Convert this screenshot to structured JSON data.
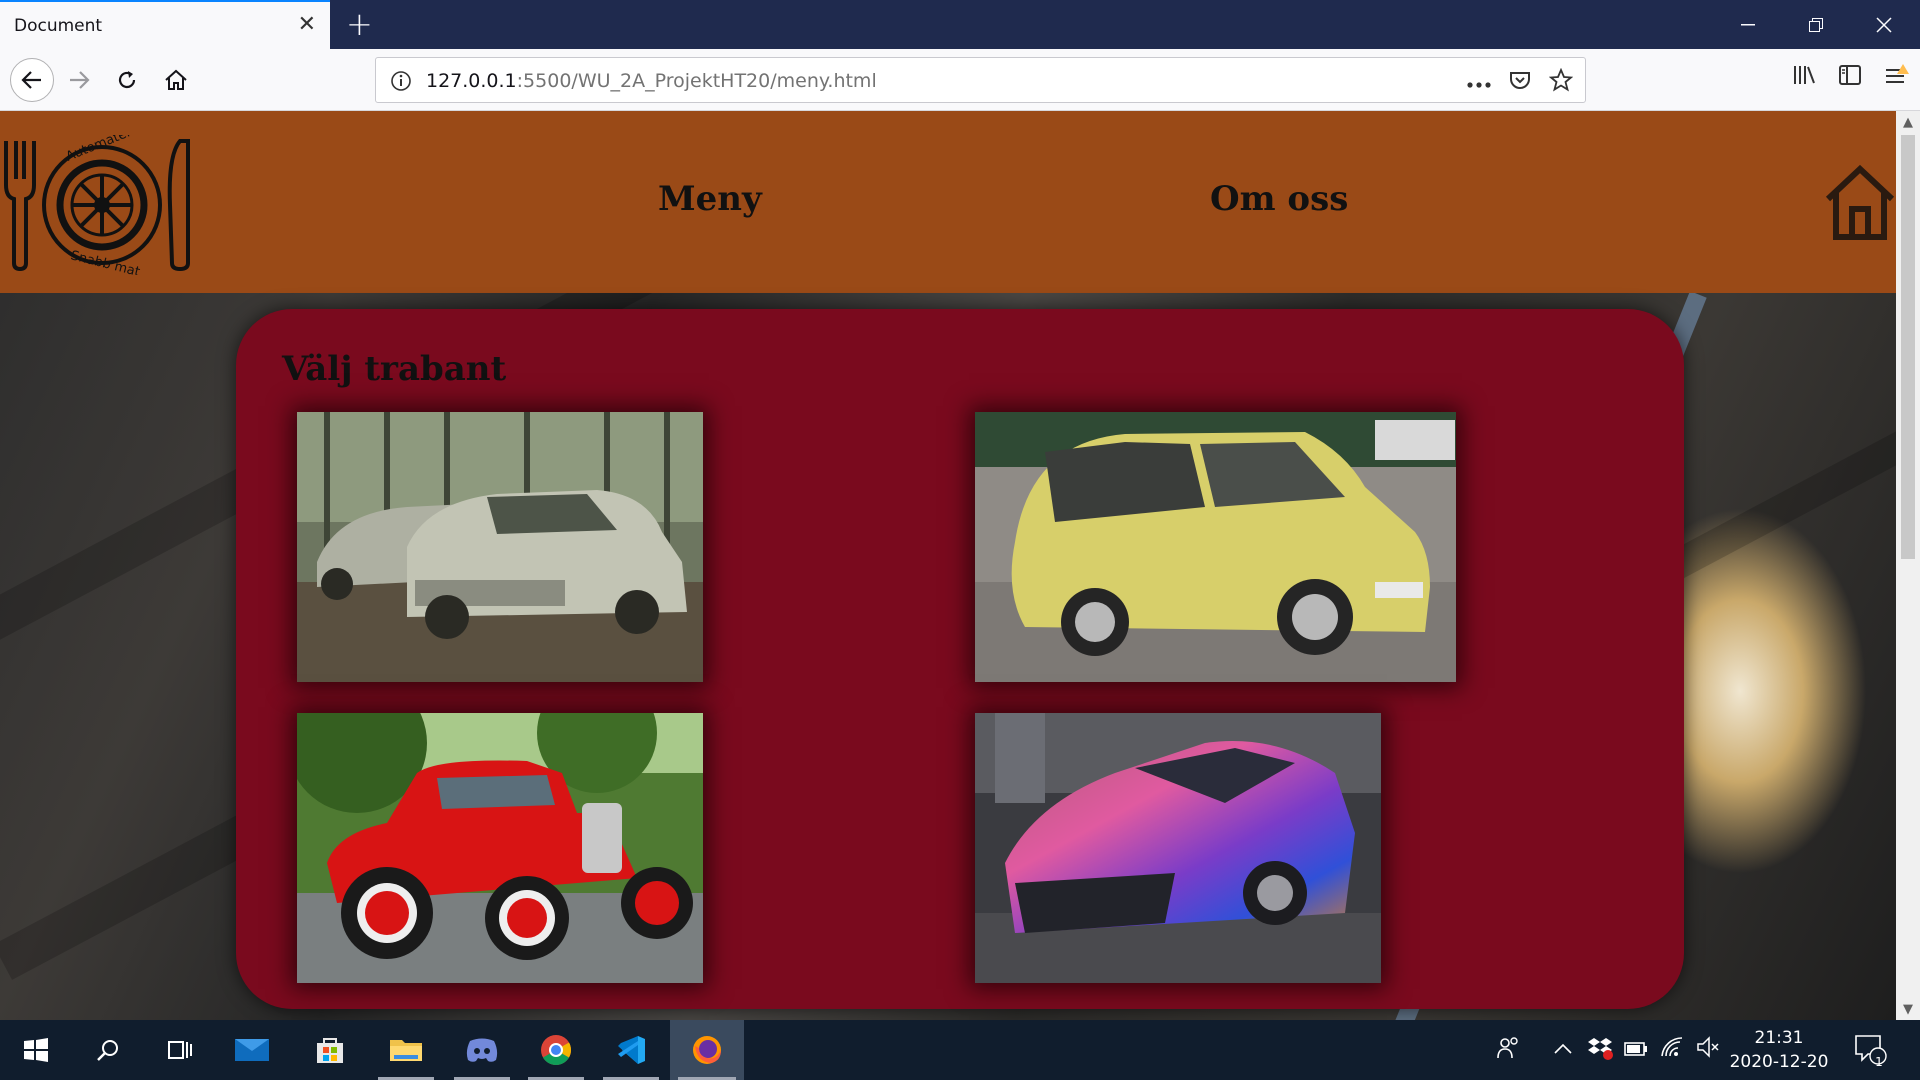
{
  "browser": {
    "tab_title": "Document",
    "tab_close": "✕",
    "new_tab": "+",
    "url_host": "127.0.0.1",
    "url_rest": ":5500/WU_2A_ProjektHT20/meny.html",
    "window_controls": [
      "minimize-icon",
      "restore-icon",
      "close-icon"
    ]
  },
  "header": {
    "logo_text_top": "Automaten",
    "logo_text_bottom": "Snabb mat",
    "nav": [
      "Meny",
      "Om oss"
    ]
  },
  "main": {
    "title": "Välj trabant",
    "images": [
      {
        "name": "photo-abandoned-trabants"
      },
      {
        "name": "photo-yellow-minivan"
      },
      {
        "name": "photo-red-hot-rod"
      },
      {
        "name": "photo-chrome-sports-car"
      }
    ]
  },
  "taskbar": {
    "clock_time": "21:31",
    "clock_date": "2020-12-20",
    "notification_count": "1"
  },
  "colors": {
    "header": "#9a4a17",
    "panel": "#7a0a1e",
    "accent": "#0a84ff"
  }
}
